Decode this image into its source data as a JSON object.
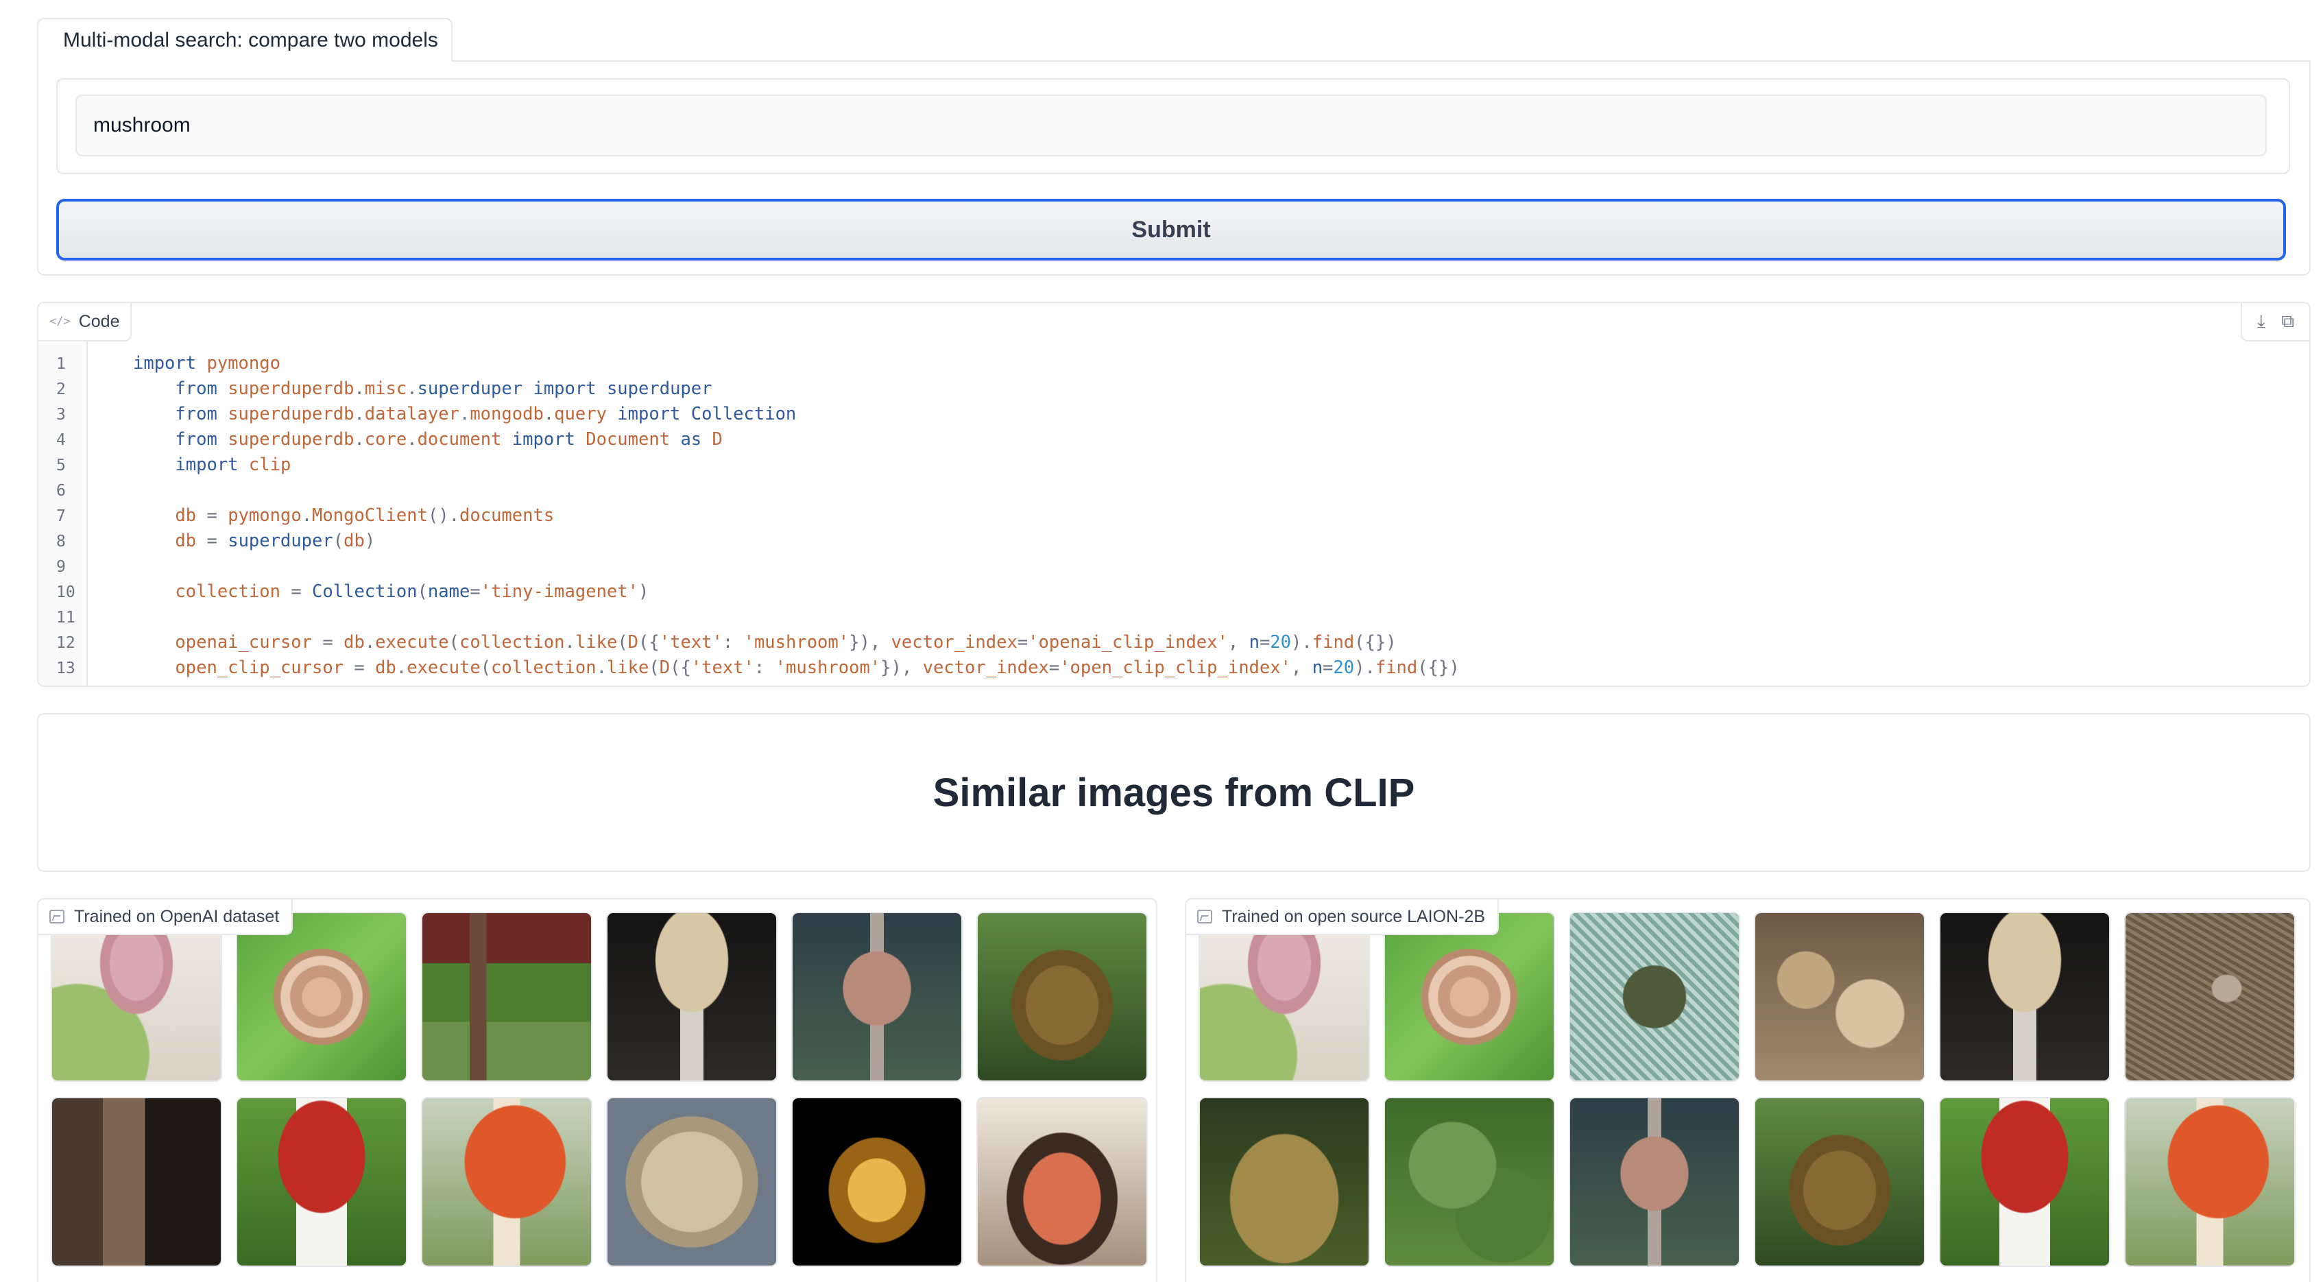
{
  "tab": {
    "label": "Multi-modal search: compare two models"
  },
  "query": {
    "value": "mushroom"
  },
  "submit": {
    "label": "Submit"
  },
  "code": {
    "label": "Code",
    "line_numbers": [
      "1",
      "2",
      "3",
      "4",
      "5",
      "6",
      "7",
      "8",
      "9",
      "10",
      "11",
      "12",
      "13"
    ],
    "lines": [
      "import pymongo",
      "    from superduperdb.misc.superduper import superduper",
      "    from superduperdb.datalayer.mongodb.query import Collection",
      "    from superduperdb.core.document import Document as D",
      "    import clip",
      "",
      "    db = pymongo.MongoClient().documents",
      "    db = superduper(db)",
      "",
      "    collection = Collection(name='tiny-imagenet')",
      "",
      "    openai_cursor = db.execute(collection.like(D({'text': 'mushroom'}), vector_index='openai_clip_index', n=20).find({})",
      "    open_clip_cursor = db.execute(collection.like(D({'text': 'mushroom'}), vector_index='open_clip_clip_index', n=20).find({})"
    ]
  },
  "heading": {
    "title": "Similar images from CLIP"
  },
  "galleries": {
    "left": {
      "label": "Trained on OpenAI dataset"
    },
    "right": {
      "label": "Trained on open source LAION-2B"
    }
  },
  "icons": {
    "code": "code-icon",
    "download": "download-icon",
    "copy": "copy-icon",
    "image": "image-icon"
  },
  "colors": {
    "accent_border": "#2563eb",
    "keyword": "#2f5a9e",
    "identifier": "#c0673a",
    "number": "#2f8fd0"
  }
}
